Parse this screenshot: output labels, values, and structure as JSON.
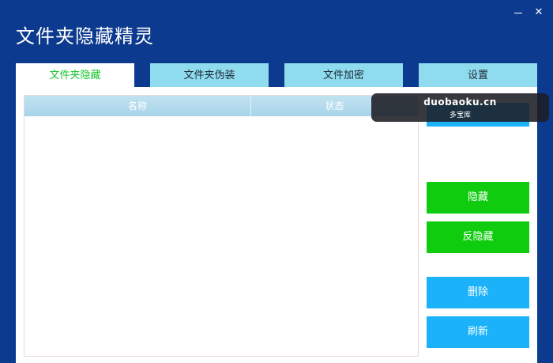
{
  "window": {
    "title": "文件夹隐藏精灵",
    "close_glyph": "✕"
  },
  "tabs": [
    {
      "label": "文件夹隐藏",
      "active": true
    },
    {
      "label": "文件夹伪装",
      "active": false
    },
    {
      "label": "文件加密",
      "active": false
    },
    {
      "label": "设置",
      "active": false
    }
  ],
  "file_list": {
    "columns": [
      "名称",
      "状态"
    ],
    "rows": []
  },
  "actions": {
    "hide": "隐藏",
    "unhide": "反隐藏",
    "delete": "删除",
    "refresh": "刷新"
  },
  "watermark": {
    "domain": "duobaoku.cn",
    "name": "多宝库"
  },
  "colors": {
    "window_bg": "#0c3a8e",
    "tab_bg": "#8fdcef",
    "active_tab_text": "#16c52a",
    "green_button": "#0fcc0f",
    "blue_button": "#1cb2fa"
  }
}
